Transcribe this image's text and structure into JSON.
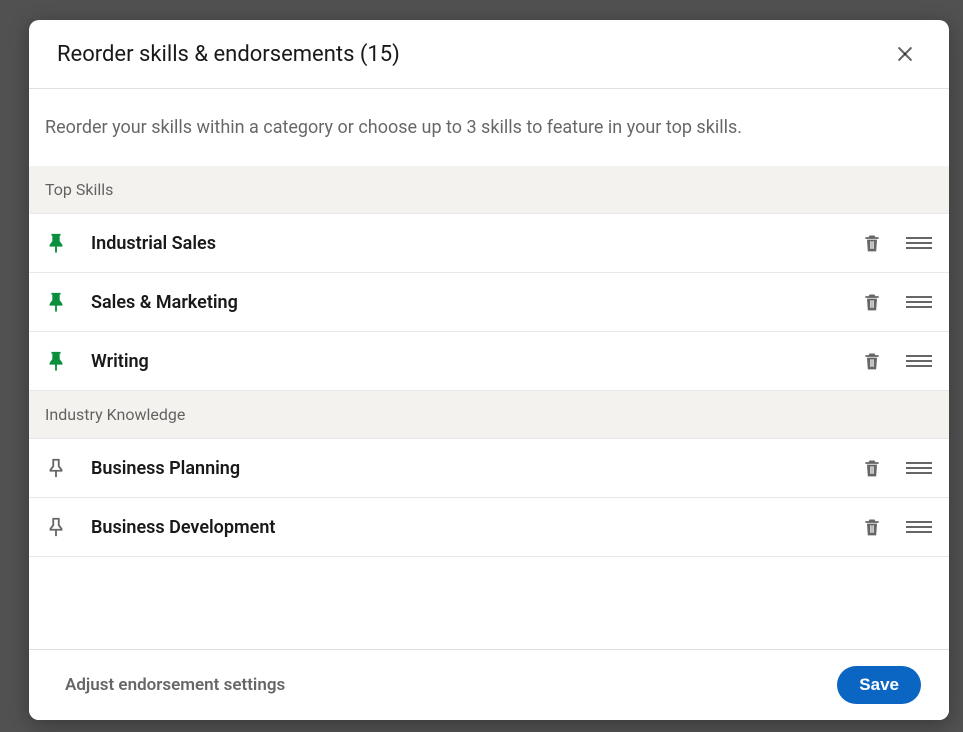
{
  "modal": {
    "title": "Reorder skills & endorsements (15)",
    "description": "Reorder your skills within a category or choose up to 3 skills to feature in your top skills."
  },
  "categories": [
    {
      "name": "Top Skills",
      "skills": [
        {
          "name": "Industrial Sales",
          "pinned": true
        },
        {
          "name": "Sales & Marketing",
          "pinned": true
        },
        {
          "name": "Writing",
          "pinned": true
        }
      ]
    },
    {
      "name": "Industry Knowledge",
      "skills": [
        {
          "name": "Business Planning",
          "pinned": false
        },
        {
          "name": "Business Development",
          "pinned": false
        }
      ]
    }
  ],
  "footer": {
    "adjust_link": "Adjust endorsement settings",
    "save_label": "Save"
  }
}
